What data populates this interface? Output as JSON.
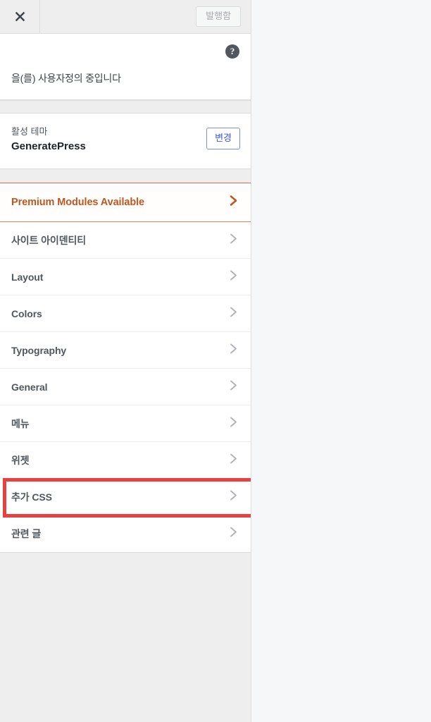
{
  "panel": {
    "header": {
      "close_icon": "close-x-icon",
      "publish_label": "발행함"
    },
    "customizing": {
      "help_icon_label": "?",
      "title": "을(를) 사용자정의 중입니다"
    },
    "theme": {
      "label": "활성 테마",
      "name": "GeneratePress",
      "change_label": "변경"
    },
    "sections": [
      {
        "label": "Premium Modules Available",
        "chevron": "chevron-right-icon",
        "highlighted": false,
        "accent": "#c0561f"
      },
      {
        "label": "사이트 아이덴티티",
        "chevron": "chevron-right-icon",
        "highlighted": false
      },
      {
        "label": "Layout",
        "chevron": "chevron-right-icon",
        "highlighted": false
      },
      {
        "label": "Colors",
        "chevron": "chevron-right-icon",
        "highlighted": false
      },
      {
        "label": "Typography",
        "chevron": "chevron-right-icon",
        "highlighted": false
      },
      {
        "label": "General",
        "chevron": "chevron-right-icon",
        "highlighted": false
      },
      {
        "label": "메뉴",
        "chevron": "chevron-right-icon",
        "highlighted": false
      },
      {
        "label": "위젯",
        "chevron": "chevron-right-icon",
        "highlighted": false
      },
      {
        "label": "추가 CSS",
        "chevron": "chevron-right-icon",
        "highlighted": true
      },
      {
        "label": "관련 글",
        "chevron": "chevron-right-icon",
        "highlighted": false
      }
    ]
  },
  "annotation": {
    "highlight_color": "#e8413f",
    "highlight_target": "추가 CSS"
  },
  "colors": {
    "panel_bg": "#eeeeee",
    "row_bg": "#ffffff",
    "text": "#50575e",
    "accent_orange": "#c0561f",
    "accent_blue": "#3858e9",
    "preview_bg": "#f6f7f8"
  }
}
